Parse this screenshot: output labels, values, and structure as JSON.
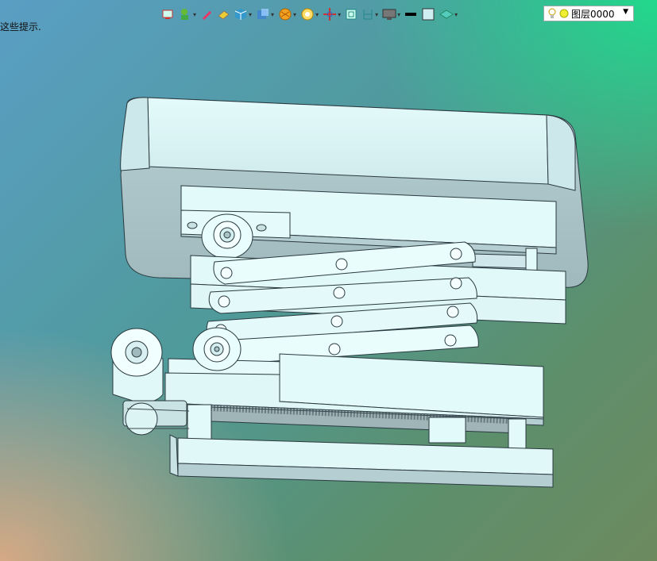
{
  "hint_text": "这些提示.",
  "toolbar": {
    "items": [
      {
        "icon": "display-icon"
      },
      {
        "icon": "bulb-tool-icon",
        "dropdown": true
      },
      {
        "icon": "pencil-icon"
      },
      {
        "icon": "eraser-icon"
      },
      {
        "icon": "cube-icon",
        "dropdown": true
      },
      {
        "icon": "view-cube-icon",
        "dropdown": true
      },
      {
        "icon": "section-icon",
        "dropdown": true
      },
      {
        "icon": "render-icon",
        "dropdown": true
      },
      {
        "icon": "snap-icon",
        "dropdown": true
      },
      {
        "icon": "frame-icon"
      },
      {
        "icon": "dimension-icon",
        "dropdown": true
      },
      {
        "icon": "monitor-icon",
        "dropdown": true
      },
      {
        "icon": "line-weight-icon"
      },
      {
        "icon": "color-box-icon"
      },
      {
        "icon": "layer-stack-icon",
        "dropdown": true
      }
    ],
    "layer_label": "图层0000",
    "dropdown_arrow": "▼"
  },
  "colors": {
    "part_fill": "#dff8f8",
    "part_shade": "#b9d6d8",
    "part_edge": "#2a3a40"
  }
}
